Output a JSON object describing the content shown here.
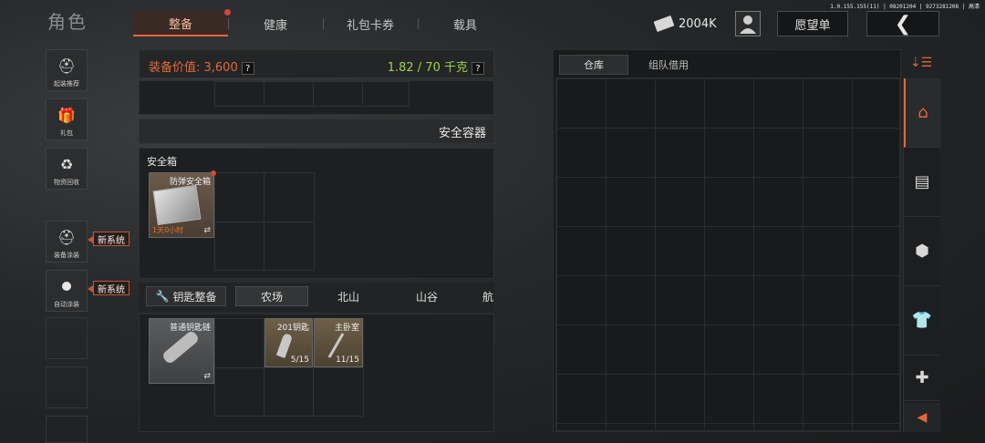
{
  "version_text": "1.0.155.155(11) | 08201204 | 9273281208 | 高清",
  "header": {
    "title": "角色",
    "tabs": [
      {
        "label": "整备"
      },
      {
        "label": "健康"
      },
      {
        "label": "礼包卡券"
      },
      {
        "label": "载具"
      }
    ],
    "active_tab": "整备",
    "money": "2004K",
    "wishlist_label": "愿望单"
  },
  "sidebar": {
    "items": [
      {
        "label": "起装推荐",
        "icon": "helmet-icon"
      },
      {
        "label": "礼包",
        "icon": "gift-icon"
      },
      {
        "label": "物资回收",
        "icon": "recycle-icon"
      },
      {
        "label": "装备涂装",
        "icon": "paint-helmet-icon"
      },
      {
        "label": "自动涂装",
        "icon": "toggle-icon"
      }
    ],
    "new_tag": "新系统"
  },
  "gear": {
    "value_label": "装备价值: 3,600",
    "help": "?",
    "weight": "1.82 / 70 千克",
    "secure_section": "安全容器",
    "safe_box_label": "安全箱",
    "safe_item": {
      "name": "防弹安全箱",
      "timer": "1天0小时",
      "swap": "⇄"
    },
    "key_button": "钥匙整备",
    "key_tabs": [
      "农场",
      "北山",
      "山谷",
      "航"
    ],
    "active_key_tab": "农场",
    "key_items": [
      {
        "name": "普通钥匙链",
        "swap": "⇄"
      },
      {
        "name": "201钥匙",
        "count": "5/15"
      },
      {
        "name": "主卧室",
        "count": "11/15"
      }
    ]
  },
  "storage": {
    "tabs": [
      "仓库",
      "组队借用"
    ],
    "active_tab": "仓库"
  },
  "right_bar": {
    "icons": [
      "sort-icon",
      "home-icon",
      "container-icon",
      "box-icon",
      "shirt-icon",
      "medkit-icon",
      "collapse-left-icon"
    ]
  },
  "colors": {
    "accent": "#e2683c",
    "weight_green": "#9cd14a",
    "new_tag_border": "#c4563a"
  }
}
